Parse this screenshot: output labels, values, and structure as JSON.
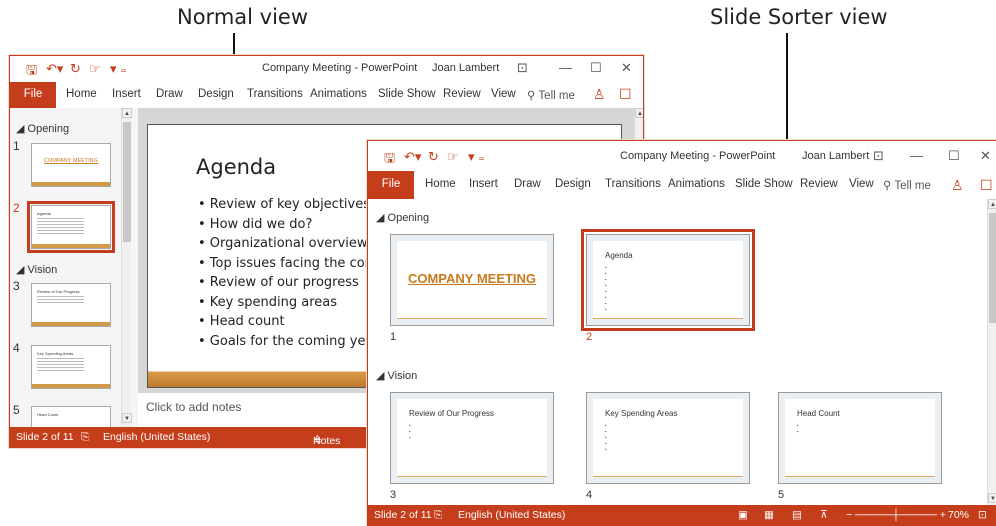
{
  "captions": {
    "normal": "Normal view",
    "sorter": "Slide Sorter view"
  },
  "normal": {
    "title": "Company Meeting - PowerPoint",
    "user": "Joan Lambert",
    "tabs": [
      "File",
      "Home",
      "Insert",
      "Draw",
      "Design",
      "Transitions",
      "Animations",
      "Slide Show",
      "Review",
      "View"
    ],
    "tellme": "Tell me",
    "sections": [
      "Opening",
      "Vision"
    ],
    "slide_numbers": [
      "1",
      "2",
      "3",
      "4",
      "5"
    ],
    "thumbs": {
      "t1": "COMPANY MEETING",
      "t2": "Agenda",
      "t3": "Review of Our Progress",
      "t4": "Key Spending Areas",
      "t5": "Head Count"
    },
    "slide": {
      "title": "Agenda",
      "bullets": [
        "• Review of key objectives",
        "• How did we do?",
        "• Organizational overview",
        "• Top issues facing the company",
        "• Review of our progress",
        "• Key spending areas",
        "• Head count",
        "• Goals for the coming year"
      ]
    },
    "notes_placeholder": "Click to add notes",
    "status": {
      "slide": "Slide 2 of 11",
      "language": "English (United States)",
      "notes": "Notes"
    }
  },
  "sorter": {
    "title": "Company Meeting - PowerPoint",
    "user": "Joan Lambert",
    "tabs": [
      "File",
      "Home",
      "Insert",
      "Draw",
      "Design",
      "Transitions",
      "Animations",
      "Slide Show",
      "Review",
      "View"
    ],
    "tellme": "Tell me",
    "sections": [
      "Opening",
      "Vision"
    ],
    "slides": [
      {
        "num": "1",
        "title": "COMPANY MEETING"
      },
      {
        "num": "2",
        "title": "Agenda"
      },
      {
        "num": "3",
        "title": "Review of Our Progress"
      },
      {
        "num": "4",
        "title": "Key Spending Areas"
      },
      {
        "num": "5",
        "title": "Head Count"
      }
    ],
    "status": {
      "slide": "Slide 2 of 11",
      "language": "English (United States)",
      "zoom": "70%"
    }
  },
  "colors": {
    "accent": "#c43e1c",
    "slide_gradient": "#c07b2c"
  }
}
